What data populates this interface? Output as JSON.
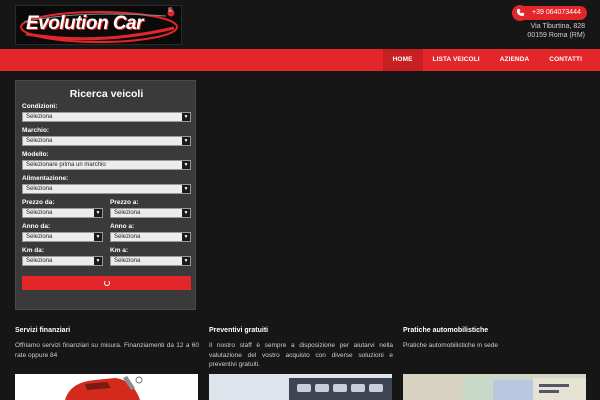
{
  "brand": {
    "logo_text": "Evolution Car",
    "logo_mark": "®",
    "accent_color": "#e3262a"
  },
  "contact": {
    "phone": "+39 064073444",
    "phone_icon": "phone-icon",
    "address_line1": "Via Tiburtina, 828",
    "address_line2": "00159 Roma (RM)"
  },
  "nav": {
    "items": [
      {
        "label": "HOME"
      },
      {
        "label": "LISTA VEICOLI"
      },
      {
        "label": "AZIENDA"
      },
      {
        "label": "CONTATTI"
      }
    ]
  },
  "search": {
    "title": "Ricerca veicoli",
    "condizioni": {
      "label": "Condizioni:",
      "value": "Seleziona"
    },
    "marchio": {
      "label": "Marchio:",
      "value": "Seleziona"
    },
    "modello": {
      "label": "Modello:",
      "value": "Selezionare prima un marchio"
    },
    "alimentazione": {
      "label": "Alimentazione:",
      "value": "Seleziona"
    },
    "prezzo_da": {
      "label": "Prezzo da:",
      "value": "Seleziona"
    },
    "prezzo_a": {
      "label": "Prezzo a:",
      "value": "Seleziona"
    },
    "anno_da": {
      "label": "Anno da:",
      "value": "Seleziona"
    },
    "anno_a": {
      "label": "Anno a:",
      "value": "Seleziona"
    },
    "km_da": {
      "label": "Km da:",
      "value": "Seleziona"
    },
    "km_a": {
      "label": "Km a:",
      "value": "Seleziona"
    },
    "button_icon": "loading-spinner-icon"
  },
  "columns": [
    {
      "title": "Servizi finanziari",
      "text": "Offriamo servizi finanziari su misura. Finanziamenti da 12 a 60 rate oppure 84"
    },
    {
      "title": "Preventivi gratuiti",
      "text": "Il nostro staff è sempre a disposizione per aiutarvi nella valutazione del vostro acquisto con diverse soluzioni e preventivi gratuiti."
    },
    {
      "title": "Pratiche automobilistiche",
      "text": "Pratiche automobilistiche in sede"
    }
  ]
}
